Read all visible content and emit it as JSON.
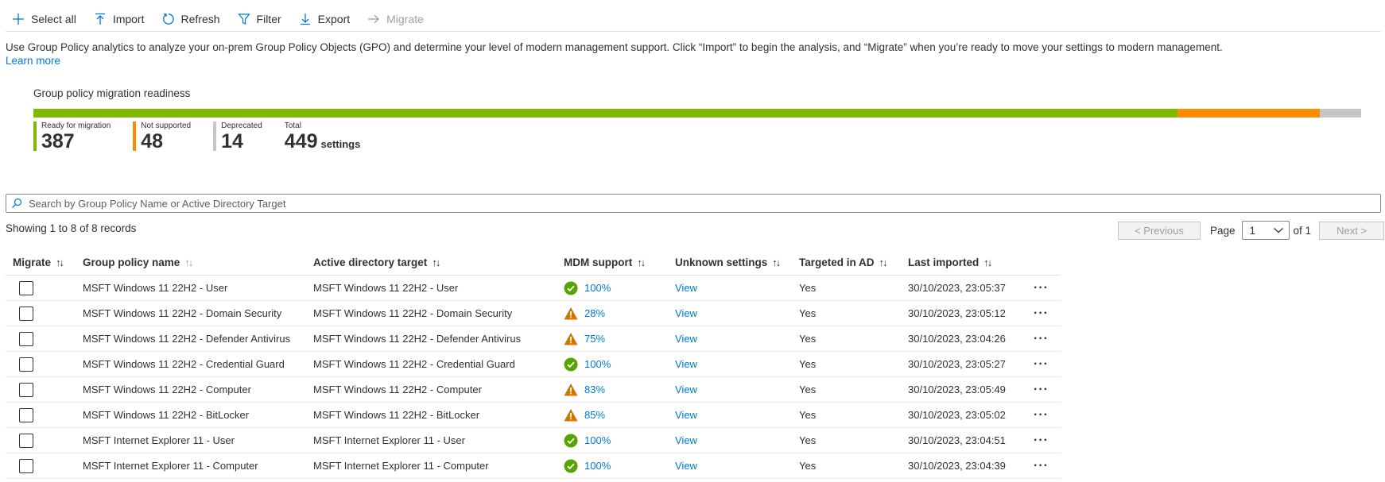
{
  "toolbar": {
    "select_all": "Select all",
    "import": "Import",
    "refresh": "Refresh",
    "filter": "Filter",
    "export": "Export",
    "migrate": "Migrate"
  },
  "description": {
    "text": "Use Group Policy analytics to analyze your on-prem Group Policy Objects (GPO) and determine your level of modern management support. Click “Import” to begin the analysis, and “Migrate” when you’re ready to move your settings to modern management.",
    "learn_more": "Learn more"
  },
  "readiness": {
    "title": "Group policy migration readiness",
    "colors": {
      "ready": "#7fba00",
      "not_supported": "#ff8c00",
      "deprecated": "#c8c6c4"
    },
    "ready_label": "Ready for migration",
    "ready_value": "387",
    "not_supported_label": "Not supported",
    "not_supported_value": "48",
    "deprecated_label": "Deprecated",
    "deprecated_value": "14",
    "total_label": "Total",
    "total_value": "449",
    "total_unit": "settings"
  },
  "search": {
    "placeholder": "Search by Group Policy Name or Active Directory Target"
  },
  "records": "Showing 1 to 8 of 8 records",
  "pagination": {
    "previous": "< Previous",
    "page_label": "Page",
    "page_value": "1",
    "of_label": "of 1",
    "next": "Next >"
  },
  "table": {
    "headers": {
      "migrate": "Migrate",
      "name": "Group policy name",
      "ad_target": "Active directory target",
      "mdm": "MDM support",
      "unknown": "Unknown settings",
      "targeted": "Targeted in AD",
      "last": "Last imported"
    },
    "rows": [
      {
        "name": "MSFT Windows 11 22H2 - User",
        "ad": "MSFT Windows 11 22H2 - User",
        "status": "ok",
        "mdm": "100%",
        "unknown": "View",
        "targeted": "Yes",
        "last": "30/10/2023, 23:05:37"
      },
      {
        "name": "MSFT Windows 11 22H2 - Domain Security",
        "ad": "MSFT Windows 11 22H2 - Domain Security",
        "status": "warning",
        "mdm": "28%",
        "unknown": "View",
        "targeted": "Yes",
        "last": "30/10/2023, 23:05:12"
      },
      {
        "name": "MSFT Windows 11 22H2 - Defender Antivirus",
        "ad": "MSFT Windows 11 22H2 - Defender Antivirus",
        "status": "warning",
        "mdm": "75%",
        "unknown": "View",
        "targeted": "Yes",
        "last": "30/10/2023, 23:04:26"
      },
      {
        "name": "MSFT Windows 11 22H2 - Credential Guard",
        "ad": "MSFT Windows 11 22H2 - Credential Guard",
        "status": "ok",
        "mdm": "100%",
        "unknown": "View",
        "targeted": "Yes",
        "last": "30/10/2023, 23:05:27"
      },
      {
        "name": "MSFT Windows 11 22H2 - Computer",
        "ad": "MSFT Windows 11 22H2 - Computer",
        "status": "warning",
        "mdm": "83%",
        "unknown": "View",
        "targeted": "Yes",
        "last": "30/10/2023, 23:05:49"
      },
      {
        "name": "MSFT Windows 11 22H2 - BitLocker",
        "ad": "MSFT Windows 11 22H2 - BitLocker",
        "status": "warning",
        "mdm": "85%",
        "unknown": "View",
        "targeted": "Yes",
        "last": "30/10/2023, 23:05:02"
      },
      {
        "name": "MSFT Internet Explorer 11 - User",
        "ad": "MSFT Internet Explorer 11 - User",
        "status": "ok",
        "mdm": "100%",
        "unknown": "View",
        "targeted": "Yes",
        "last": "30/10/2023, 23:04:51"
      },
      {
        "name": "MSFT Internet Explorer 11 - Computer",
        "ad": "MSFT Internet Explorer 11 - Computer",
        "status": "ok",
        "mdm": "100%",
        "unknown": "View",
        "targeted": "Yes",
        "last": "30/10/2023, 23:04:39"
      }
    ]
  }
}
